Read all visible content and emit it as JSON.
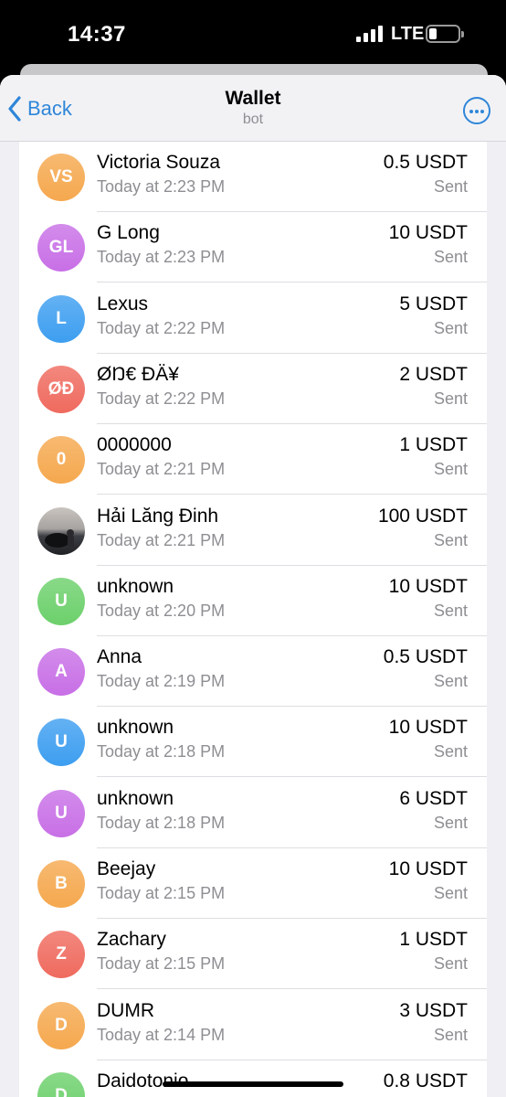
{
  "status_bar": {
    "time": "14:37",
    "network": "LTE",
    "signal_icon": "signal-bars-icon",
    "battery_icon": "battery-icon"
  },
  "nav": {
    "back_label": "Back",
    "title": "Wallet",
    "subtitle": "bot",
    "more_icon": "more-icon"
  },
  "colors": {
    "accent": "#2f86d8",
    "orange": "#f5a84e",
    "purple": "#c86fe6",
    "blue": "#3d9ef0",
    "red": "#ef6a5e",
    "green": "#6cd06b"
  },
  "transactions": [
    {
      "initials": "VS",
      "name": "Victoria Souza",
      "time": "Today at 2:23 PM",
      "amount": "0.5 USDT",
      "status": "Sent",
      "color": "#f5a84e"
    },
    {
      "initials": "GL",
      "name": "G Long",
      "time": "Today at 2:23 PM",
      "amount": "10 USDT",
      "status": "Sent",
      "color": "#c86fe6"
    },
    {
      "initials": "L",
      "name": "Lexus",
      "time": "Today at 2:22 PM",
      "amount": "5 USDT",
      "status": "Sent",
      "color": "#3d9ef0"
    },
    {
      "initials": "ØĐ",
      "name": "ØŊ€ ĐÄ¥",
      "time": "Today at 2:22 PM",
      "amount": "2 USDT",
      "status": "Sent",
      "color": "#ef6a5e"
    },
    {
      "initials": "0",
      "name": "0000000",
      "time": "Today at 2:21 PM",
      "amount": "1 USDT",
      "status": "Sent",
      "color": "#f5a84e"
    },
    {
      "initials": "",
      "name": "Hải Lăng Đinh",
      "time": "Today at 2:21 PM",
      "amount": "100 USDT",
      "status": "Sent",
      "color": "#5d6570",
      "photo": true
    },
    {
      "initials": "U",
      "name": "unknown",
      "time": "Today at 2:20 PM",
      "amount": "10 USDT",
      "status": "Sent",
      "color": "#6cd06b"
    },
    {
      "initials": "A",
      "name": "Anna",
      "time": "Today at 2:19 PM",
      "amount": "0.5 USDT",
      "status": "Sent",
      "color": "#c86fe6"
    },
    {
      "initials": "U",
      "name": "unknown",
      "time": "Today at 2:18 PM",
      "amount": "10 USDT",
      "status": "Sent",
      "color": "#3d9ef0"
    },
    {
      "initials": "U",
      "name": "unknown",
      "time": "Today at 2:18 PM",
      "amount": "6 USDT",
      "status": "Sent",
      "color": "#c86fe6"
    },
    {
      "initials": "B",
      "name": "Beejay",
      "time": "Today at 2:15 PM",
      "amount": "10 USDT",
      "status": "Sent",
      "color": "#f5a84e"
    },
    {
      "initials": "Z",
      "name": "Zachary",
      "time": "Today at 2:15 PM",
      "amount": "1 USDT",
      "status": "Sent",
      "color": "#ef6a5e"
    },
    {
      "initials": "D",
      "name": "DUMR",
      "time": "Today at 2:14 PM",
      "amount": "3 USDT",
      "status": "Sent",
      "color": "#f5a84e"
    },
    {
      "initials": "D",
      "name": "Daidotonio",
      "time": "",
      "amount": "0.8 USDT",
      "status": "",
      "color": "#6cd06b"
    }
  ]
}
